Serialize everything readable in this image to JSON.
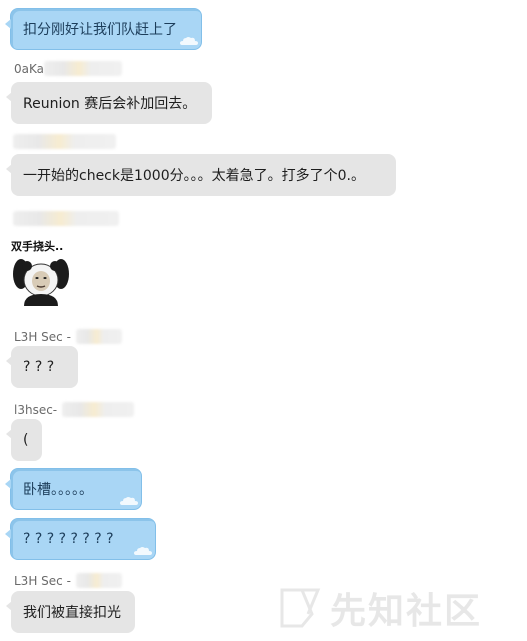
{
  "messages": [
    {
      "text": "扣分刚好让我们队赶上了",
      "style": "outgoing"
    },
    {
      "sender": "0aKa",
      "text": "Reunion 赛后会补加回去。",
      "style": "incoming"
    },
    {
      "sender": "",
      "text": "一开始的check是1000分。。。太着急了。打多了个0.。",
      "style": "incoming"
    },
    {
      "sender": "",
      "sticker_caption": "双手挠头..",
      "style": "incoming"
    },
    {
      "sender": "L3H Sec -",
      "text": "? ? ?",
      "style": "incoming"
    },
    {
      "sender": "l3hsec-",
      "text": "(",
      "style": "incoming"
    },
    {
      "text": "卧槽。。。。。",
      "style": "outgoing"
    },
    {
      "text": "? ? ? ? ? ? ? ?",
      "style": "outgoing"
    },
    {
      "sender": "L3H Sec -",
      "text": "我们被直接扣光",
      "style": "incoming"
    }
  ],
  "watermark": {
    "text": "先知社区",
    "logo_icon": "xianzhi-logo-icon"
  },
  "colors": {
    "incoming_bubble": "#e5e5e5",
    "outgoing_bubble": "#a9d6f5",
    "outgoing_border": "#82bfe9",
    "sender_name": "#6a6a6a"
  }
}
